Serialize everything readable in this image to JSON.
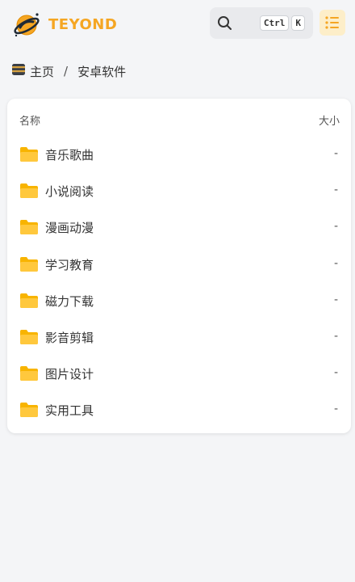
{
  "header": {
    "logo_text": "TEYOND",
    "search_shortcut_keys": [
      "Ctrl",
      "K"
    ],
    "icons": {
      "logo": "planet-logo-icon",
      "search": "search-icon",
      "menu": "list-menu-icon"
    },
    "accent_color": "#f5a623"
  },
  "breadcrumb": {
    "home_label": "主页",
    "separator": "/",
    "current_label": "安卓软件"
  },
  "file_list": {
    "column_name": "名称",
    "column_size": "大小",
    "items": [
      {
        "name": "音乐歌曲",
        "size": "-",
        "icon": "folder-icon"
      },
      {
        "name": "小说阅读",
        "size": "-",
        "icon": "folder-icon"
      },
      {
        "name": "漫画动漫",
        "size": "-",
        "icon": "folder-icon"
      },
      {
        "name": "学习教育",
        "size": "-",
        "icon": "folder-icon"
      },
      {
        "name": "磁力下载",
        "size": "-",
        "icon": "folder-icon"
      },
      {
        "name": "影音剪辑",
        "size": "-",
        "icon": "folder-icon"
      },
      {
        "name": "图片设计",
        "size": "-",
        "icon": "folder-icon"
      },
      {
        "name": "实用工具",
        "size": "-",
        "icon": "folder-icon"
      }
    ]
  }
}
